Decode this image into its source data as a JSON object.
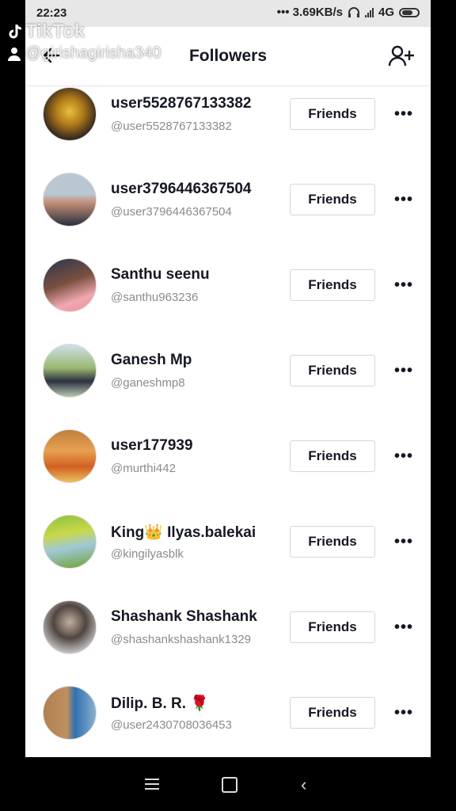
{
  "status_bar": {
    "time": "22:23",
    "network_speed": "••• 3.69KB/s",
    "network_type": "4G"
  },
  "watermark": {
    "brand": "TikTok",
    "username": "@girishagirisha340"
  },
  "header": {
    "title": "Followers",
    "back_icon": "back-arrow-icon",
    "add_icon": "add-friend-icon"
  },
  "followers": [
    {
      "name": "user5528767133382",
      "handle": "@user5528767133382",
      "button": "Friends",
      "more": "•••"
    },
    {
      "name": "user3796446367504",
      "handle": "@user3796446367504",
      "button": "Friends",
      "more": "•••"
    },
    {
      "name": "Santhu seenu",
      "handle": "@santhu963236",
      "button": "Friends",
      "more": "•••"
    },
    {
      "name": "Ganesh Mp",
      "handle": "@ganeshmp8",
      "button": "Friends",
      "more": "•••"
    },
    {
      "name": "user177939",
      "handle": "@murthi442",
      "button": "Friends",
      "more": "•••"
    },
    {
      "name": "King👑 Ilyas.balekai",
      "handle": "@kingilyasblk",
      "button": "Friends",
      "more": "•••"
    },
    {
      "name": "Shashank Shashank",
      "handle": "@shashankshashank1329",
      "button": "Friends",
      "more": "•••"
    },
    {
      "name": "Dilip. B. R. 🌹",
      "handle": "@user2430708036453",
      "button": "Friends",
      "more": "•••"
    }
  ],
  "colors": {
    "text": "#161823",
    "secondary": "#8a8b91",
    "border": "#d6d6d9"
  }
}
